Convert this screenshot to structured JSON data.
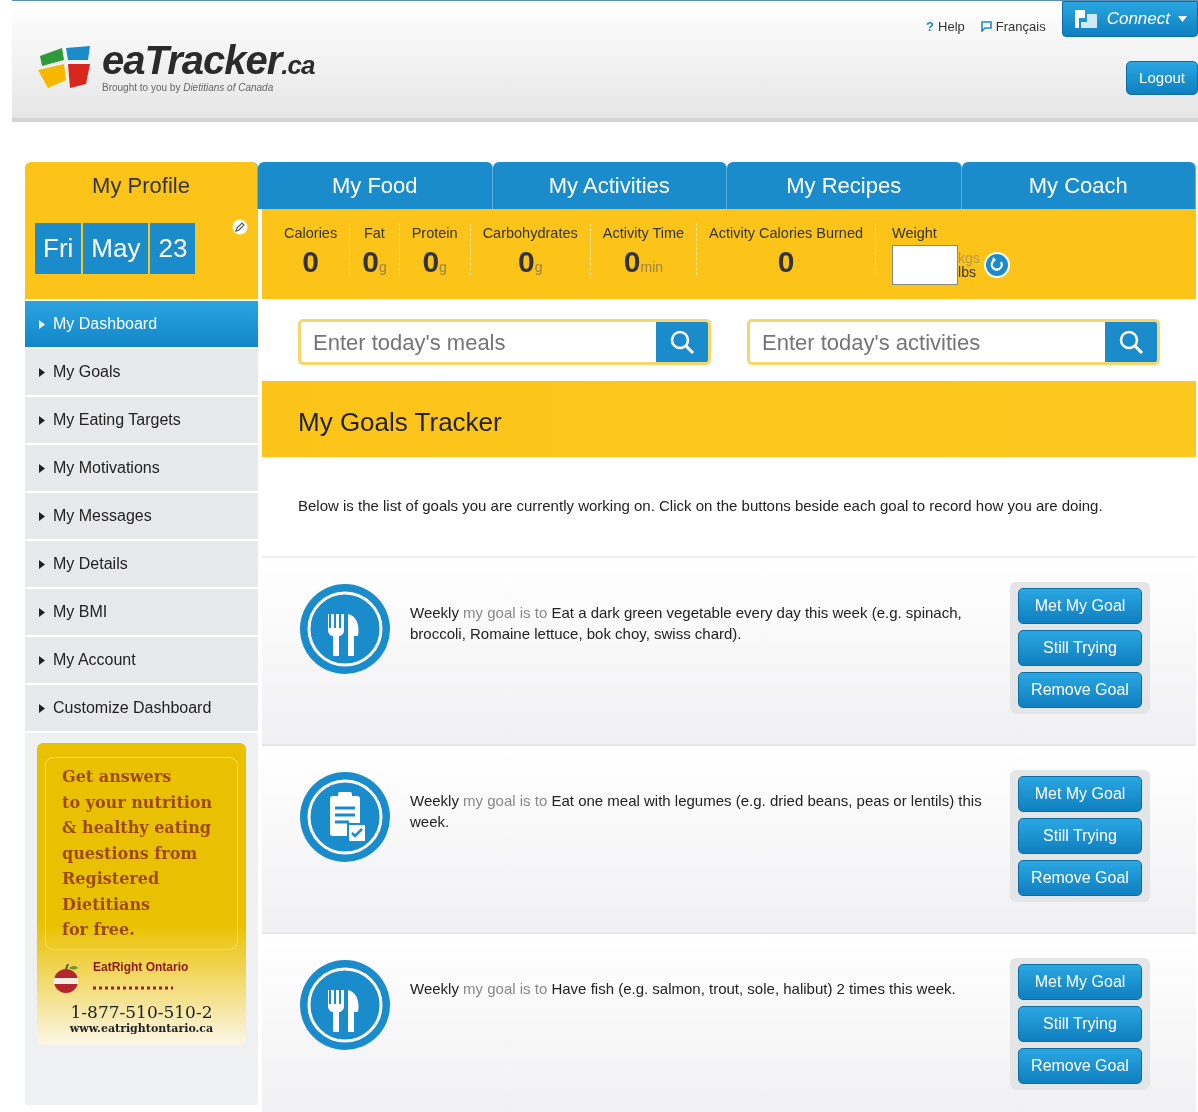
{
  "header": {
    "logo": {
      "name": "eaTracker",
      "suffix": ".ca",
      "tagline": "Brought to you by *Dietitians of Canada*"
    },
    "links": [
      {
        "icon": "?",
        "label": "Help"
      },
      {
        "kind": "bubble",
        "label": "Français"
      }
    ],
    "connect": "Connect",
    "logout": "Logout"
  },
  "tabs": [
    {
      "label": "My Profile",
      "selected": true
    },
    {
      "label": "My Food",
      "selected": false
    },
    {
      "label": "My Activities",
      "selected": false
    },
    {
      "label": "My Recipes",
      "selected": false
    },
    {
      "label": "My Coach",
      "selected": false
    }
  ],
  "date": [
    "Fri",
    "May",
    "23"
  ],
  "stats": [
    {
      "label": "Calories",
      "value": "0"
    },
    {
      "label": "Fat",
      "value": "0",
      "unit": "g"
    },
    {
      "label": "Protein",
      "value": "0",
      "unit": "g"
    },
    {
      "label": "Carbohydrates",
      "value": "0",
      "unit": "g"
    },
    {
      "label": "Activity Time",
      "value": "0",
      "unit": "min"
    },
    {
      "label": "Activity Calories Burned",
      "value": "0"
    }
  ],
  "weight": {
    "label": "Weight",
    "units": [
      {
        "label": "kgs",
        "selected": false
      },
      {
        "label": "lbs",
        "selected": true
      }
    ]
  },
  "sidebar": {
    "items": [
      {
        "label": "My Dashboard",
        "selected": true
      },
      {
        "label": "My Goals",
        "selected": false
      },
      {
        "label": "My Eating Targets",
        "selected": false
      },
      {
        "label": "My Motivations",
        "selected": false
      },
      {
        "label": "My Messages",
        "selected": false
      },
      {
        "label": "My Details",
        "selected": false
      },
      {
        "label": "My BMI",
        "selected": false
      },
      {
        "label": "My Account",
        "selected": false
      },
      {
        "label": "Customize Dashboard",
        "selected": false
      }
    ],
    "ad": {
      "lines": [
        "Get answers",
        "to your nutrition",
        "& healthy eating",
        "questions from",
        "Registered",
        "Dietitians",
        "for free."
      ],
      "brand": "EatRight Ontario",
      "phone": "1-877-510-510-2",
      "url": "www.eatrightontario.ca"
    }
  },
  "searches": [
    {
      "placeholder": "Enter today's meals"
    },
    {
      "placeholder": "Enter today's activities"
    }
  ],
  "tracker": {
    "title": "My Goals Tracker",
    "intro": "Below is the list of goals you are currently working on. Click on the buttons beside each goal to record how you are doing.",
    "goals": [
      {
        "kind": "meal",
        "period": "Weekly",
        "connector": "my goal is to",
        "text": "Eat a dark green vegetable every day this week (e.g. spinach, broccoli, Romaine lettuce, bok choy, swiss chard).",
        "buttons": [
          "Met My Goal",
          "Still Trying",
          "Remove Goal"
        ]
      },
      {
        "kind": "checklist",
        "period": "Weekly",
        "connector": "my goal is to",
        "text": "Eat one meal with legumes (e.g. dried beans, peas or lentils) this week.",
        "buttons": [
          "Met My Goal",
          "Still Trying",
          "Remove Goal"
        ]
      },
      {
        "kind": "meal",
        "period": "Weekly",
        "connector": "my goal is to",
        "text": "Have fish (e.g. salmon, trout, sole, halibut) 2 times this week.",
        "buttons": [
          "Met My Goal",
          "Still Trying",
          "Remove Goal"
        ]
      }
    ]
  }
}
